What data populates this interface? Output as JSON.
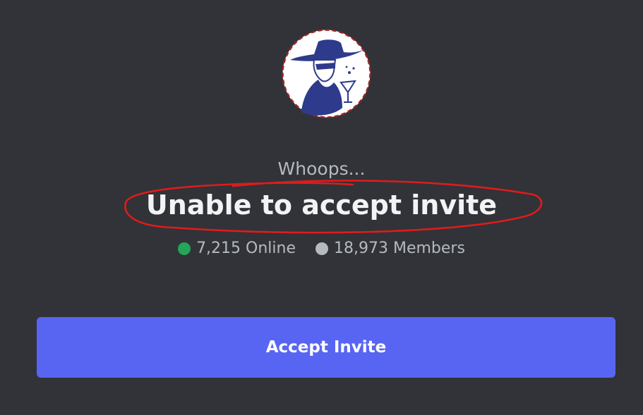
{
  "invite": {
    "eyebrow": "Whoops...",
    "title": "Unable to accept invite",
    "online_label": "7,215 Online",
    "members_label": "18,973 Members",
    "accept_label": "Accept Invite"
  },
  "colors": {
    "background": "#313338",
    "online": "#23a55a",
    "members": "#b5bac1",
    "accent_button": "#5865f2",
    "annotation": "#e01b1b",
    "avatar_figure": "#2e3a8c"
  },
  "icons": {
    "server_avatar": "server-logo-icon"
  }
}
